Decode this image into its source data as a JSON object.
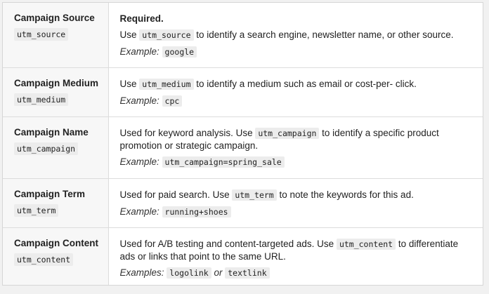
{
  "rows": [
    {
      "name": "Campaign Source",
      "code": "utm_source",
      "required": "Required.",
      "desc_pre": "Use ",
      "desc_code": "utm_source",
      "desc_post": " to identify a search engine, newsletter name, or other source.",
      "example_label": "Example:",
      "example": "google"
    },
    {
      "name": "Campaign Medium",
      "code": "utm_medium",
      "desc_pre": "Use ",
      "desc_code": "utm_medium",
      "desc_post": " to identify a medium such as email or cost-per- click.",
      "example_label": "Example:",
      "example": "cpc"
    },
    {
      "name": "Campaign Name",
      "code": "utm_campaign",
      "desc_pre": "Used for keyword analysis. Use ",
      "desc_code": "utm_campaign",
      "desc_post": " to identify a specific product promotion or strategic campaign.",
      "example_label": "Example:",
      "example": "utm_campaign=spring_sale"
    },
    {
      "name": "Campaign Term",
      "code": "utm_term",
      "desc_pre": "Used for paid search. Use ",
      "desc_code": "utm_term",
      "desc_post": " to note the keywords for this ad.",
      "example_label": "Example:",
      "example": "running+shoes"
    },
    {
      "name": "Campaign Content",
      "code": "utm_content",
      "desc_pre": "Used for A/B testing and content-targeted ads. Use ",
      "desc_code": "utm_content",
      "desc_post": " to differentiate ads or links that point to the same URL.",
      "example_label": "Examples:",
      "example": "logolink",
      "example_or": "or",
      "example2": "textlink"
    }
  ]
}
